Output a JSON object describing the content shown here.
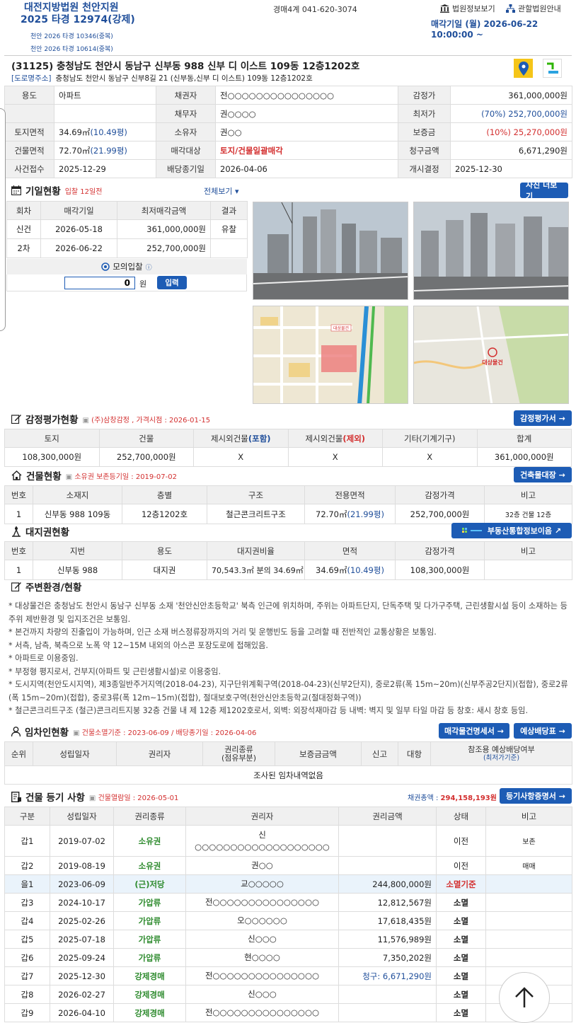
{
  "header": {
    "court": "대전지방법원 천안지원",
    "case_no": "2025 타경 12974(강제)",
    "related_cases": [
      "천안 2026 타경 10346(중복)",
      "천안 2026 타경 10614(중복)"
    ],
    "dept_phone": "경매4계 041-620-3074",
    "court_info_link": "법원정보보기",
    "jurisdiction_link": "관할법원안내",
    "sale_date": "매각기일 (월) 2026-06-22 10:00:00 ~"
  },
  "address": {
    "main": "(31125) 충청남도 천안시 동남구 신부동 988 신부 디 이스트 109동 12층1202호",
    "road_tag": "[도로명주소]",
    "road": "충청남도 천안시 동남구 신부8길 21 (신부동,신부 디 이스트) 109동 12층1202호"
  },
  "summary": {
    "rows": [
      [
        "용도",
        "아파트",
        "채권자",
        "전○○○○○○○○○○○○○○○",
        "감정가",
        "361,000,000원"
      ],
      [
        "",
        "",
        "채무자",
        "권○○○○",
        "최저가",
        "(70%) 252,700,000원"
      ],
      [
        "토지면적",
        "34.69㎡",
        "소유자",
        "권○○",
        "보증금",
        "(10%) 25,270,000원"
      ],
      [
        "건물면적",
        "72.70㎡",
        "매각대상",
        "토지/건물일괄매각",
        "청구금액",
        "6,671,290원"
      ],
      [
        "사건접수",
        "2025-12-29",
        "배당종기일",
        "2026-04-06",
        "개시결정",
        "2025-12-30"
      ]
    ],
    "land_pyeong": "(10.49평)",
    "bldg_pyeong": "(21.99평)"
  },
  "auction_history": {
    "title": "기일현황",
    "badge": "입찰 12일전",
    "view_all": "전체보기",
    "more_photos": "사진 더보기",
    "headers": [
      "회차",
      "매각기일",
      "최저매각금액",
      "결과"
    ],
    "rows": [
      [
        "신건",
        "2026-05-18",
        "361,000,000원",
        "유찰"
      ],
      [
        "2차",
        "2026-06-22",
        "252,700,000원",
        ""
      ]
    ],
    "mock_bid_label": "모의입찰",
    "mock_bid_value": "0",
    "won": "원",
    "input_btn": "입력"
  },
  "map_labels": {
    "map1": "대상물건",
    "map2": "대상물건"
  },
  "appraisal": {
    "title": "감정평가현황",
    "note": "(주)삼창감정 , 가격시점 : 2026-01-15",
    "btn": "감정평가서 →",
    "headers": [
      "토지",
      "건물",
      "제시외건물",
      "제시외건물",
      "기타(기계기구)",
      "합계"
    ],
    "header_suffix": [
      "",
      "",
      "(포함)",
      "(제외)",
      "",
      ""
    ],
    "values": [
      "108,300,000원",
      "252,700,000원",
      "X",
      "X",
      "X",
      "361,000,000원"
    ]
  },
  "building": {
    "title": "건물현황",
    "note": "소유권 보존등기일 : 2019-07-02",
    "btn": "건축물대장 →",
    "headers": [
      "번호",
      "소재지",
      "층별",
      "구조",
      "전용면적",
      "감정가격",
      "비고"
    ],
    "row": [
      "1",
      "신부동 988 109동",
      "12층1202호",
      "철근콘크리트구조",
      "72.70㎡",
      "252,700,000원",
      "32층 건물 12층"
    ],
    "pyeong": "(21.99평)"
  },
  "land_right": {
    "title": "대지권현황",
    "btn": "부동산통합정보이음 ↗",
    "headers": [
      "번호",
      "지번",
      "용도",
      "대지권비율",
      "면적",
      "감정가격",
      "비고"
    ],
    "row": [
      "1",
      "신부동 988",
      "대지권",
      "70,543.3㎡ 분의 34.69㎡",
      "34.69㎡",
      "108,300,000원",
      ""
    ],
    "pyeong": "(10.49평)"
  },
  "surroundings": {
    "title": "주변환경/현황",
    "lines": [
      "* 대상물건은 충청남도 천안시 동남구 신부동 소재 '천안신안초등학교' 북측 인근에 위치하며, 주위는 아파트단지, 단독주택 및 다가구주택, 근린생활시설 등이 소재하는 등 주위 제반환경 및 입지조건은 보통임.",
      "* 본건까지 차량의 진출입이 가능하며, 인근 소재 버스정류장까지의 거리 및 운행빈도 등을 고려할 때 전반적인 교통상황은 보통임.",
      "* 서측, 남측, 북측으로 노폭 약 12~15M 내외의 아스콘 포장도로에 접해있음.",
      "* 아파트로 이용중임.",
      "* 부정형 평지로서, 건부지(아파트 및 근린생활시설)로 이용중임.",
      "* 도시지역(천안도시지역), 제3종일반주거지역(2018-04-23), 지구단위계획구역(2018-04-23)(신부2단지), 중로2류(폭 15m~20m)(신부주공2단지)(접합), 중로2류(폭 15m~20m)(접합), 중로3류(폭 12m~15m)(접합), 절대보호구역(천안신안초등학교(절대정화구역))",
      "* 철근콘크리트구조 (철근)콘크리트지붕 32층 건물 내 제 12층 제1202호로서, 외벽: 외장석재마감 등 내벽: 벽지 및 일부 타일 마감 등 창호: 새시 창호 등임."
    ]
  },
  "tenants": {
    "title": "임차인현황",
    "note": "건물소멸기준 : 2023-06-09 / 배당종기일 : 2026-04-06",
    "btn1": "매각물건명세서 →",
    "btn2": "예상배당표 →",
    "headers": [
      "순위",
      "성립일자",
      "권리자",
      "권리종류",
      "보증금금액",
      "신고",
      "대항",
      "참조용 예상배당여부"
    ],
    "header_sub": [
      "",
      "",
      "",
      "(점유부분)",
      "",
      "",
      "",
      "(최저가기준)"
    ],
    "empty": "조사된 임차내역없음"
  },
  "registry": {
    "title": "건물 등기 사항",
    "note": "건물열람일 : 2026-05-01",
    "total_label": "채권총액 : ",
    "total_value": "294,158,193원",
    "btn": "등기사항증명서 →",
    "headers": [
      "구분",
      "성립일자",
      "권리종류",
      "권리자",
      "권리금액",
      "상태",
      "비고"
    ],
    "rows": [
      {
        "k": "갑1",
        "d": "2019-07-02",
        "t": "소유권",
        "p": "신\n○○○○○○○○○○○○○○○○○○○",
        "a": "",
        "s": "이전",
        "n": "보존"
      },
      {
        "k": "갑2",
        "d": "2019-08-19",
        "t": "소유권",
        "p": "권○○",
        "a": "",
        "s": "이전",
        "n": "매매"
      },
      {
        "k": "을1",
        "d": "2023-06-09",
        "t": "(근)저당",
        "p": "교○○○○○",
        "a": "244,800,000원",
        "s": "소멸기준",
        "n": ""
      },
      {
        "k": "갑3",
        "d": "2024-10-17",
        "t": "가압류",
        "p": "전○○○○○○○○○○○○○○○",
        "a": "12,812,567원",
        "s": "소멸",
        "n": ""
      },
      {
        "k": "갑4",
        "d": "2025-02-26",
        "t": "가압류",
        "p": "오○○○○○○",
        "a": "17,618,435원",
        "s": "소멸",
        "n": ""
      },
      {
        "k": "갑5",
        "d": "2025-07-18",
        "t": "가압류",
        "p": "신○○○",
        "a": "11,576,989원",
        "s": "소멸",
        "n": ""
      },
      {
        "k": "갑6",
        "d": "2025-09-24",
        "t": "가압류",
        "p": "현○○○○",
        "a": "7,350,202원",
        "s": "소멸",
        "n": ""
      },
      {
        "k": "갑7",
        "d": "2025-12-30",
        "t": "강제경매",
        "p": "전○○○○○○○○○○○○○○○",
        "a": "청구: 6,671,290원",
        "s": "소멸",
        "n": ""
      },
      {
        "k": "갑8",
        "d": "2026-02-27",
        "t": "강제경매",
        "p": "신○○○",
        "a": "",
        "s": "소멸",
        "n": ""
      },
      {
        "k": "갑9",
        "d": "2026-04-10",
        "t": "강제경매",
        "p": "전○○○○○○○○○○○○○○○",
        "a": "",
        "s": "소멸",
        "n": ""
      }
    ]
  },
  "colors": {
    "brand": "#1f4e9a",
    "button": "#1d5cb5",
    "alert": "#d32f2f",
    "green": "#2e8b2e"
  }
}
